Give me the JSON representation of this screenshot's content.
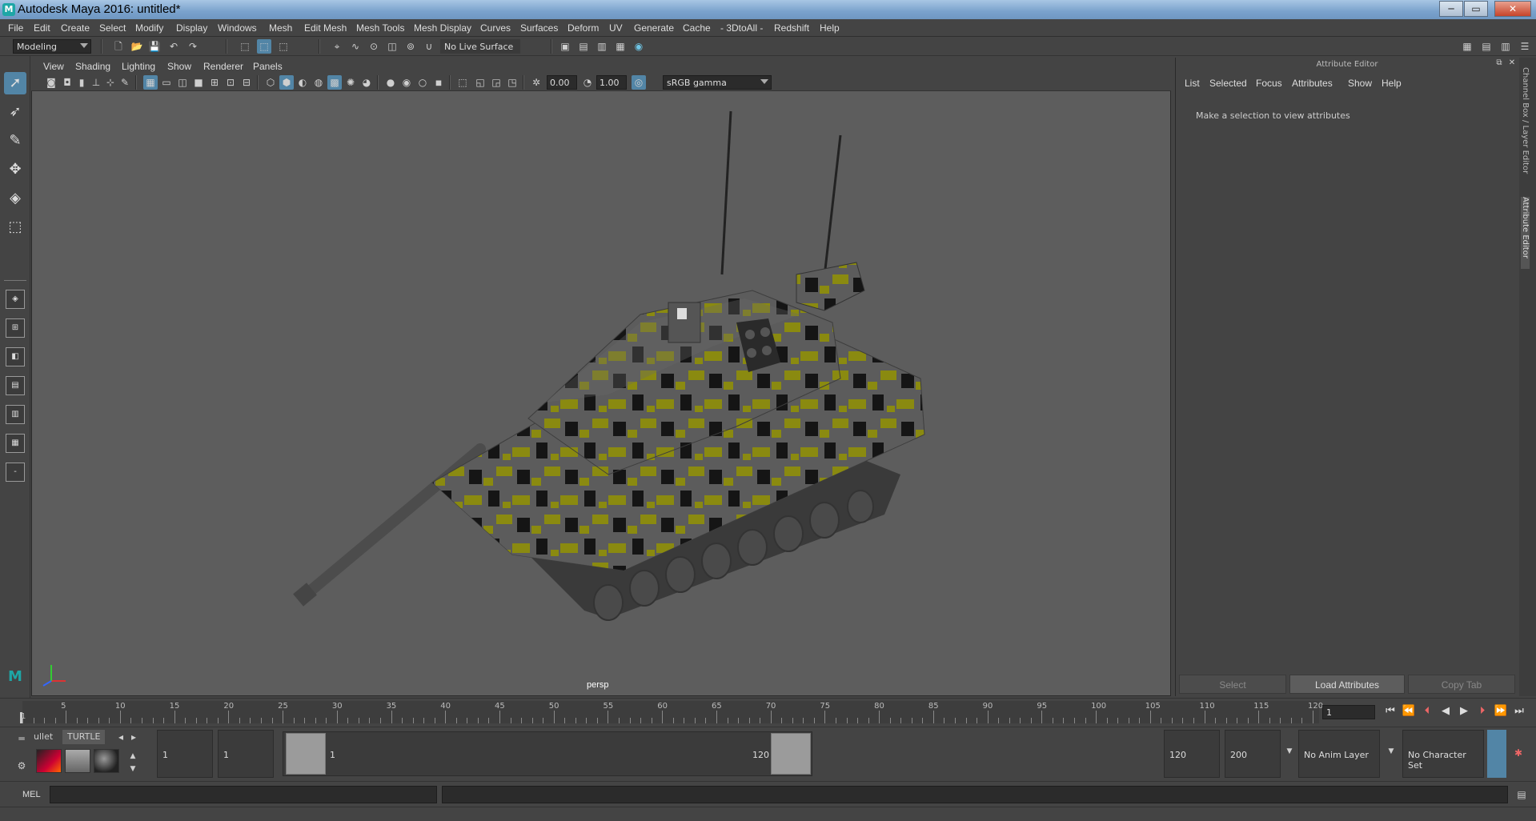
{
  "window": {
    "title": "Autodesk Maya 2016: untitled*",
    "minimize": "─",
    "maximize": "▭",
    "close": "✕"
  },
  "menu": [
    "File",
    "Edit",
    "Create",
    "Select",
    "Modify",
    "Display",
    "Windows",
    "Mesh",
    "Edit Mesh",
    "Mesh Tools",
    "Mesh Display",
    "Curves",
    "Surfaces",
    "Deform",
    "UV",
    "Generate",
    "Cache",
    "- 3DtoAll -",
    "Redshift",
    "Help"
  ],
  "status_line": {
    "mode": "Modeling",
    "live_surface": "No Live Surface"
  },
  "viewport": {
    "menu": [
      "View",
      "Shading",
      "Lighting",
      "Show",
      "Renderer",
      "Panels"
    ],
    "exposure": "0.00",
    "gamma": "1.00",
    "color_space": "sRGB gamma",
    "camera": "persp",
    "colors": {
      "bg": "#5d5d5d",
      "camo_yellow": "#8a8a10",
      "camo_black": "#151515",
      "hull": "#5e5e5e"
    }
  },
  "attribute_editor": {
    "title": "Attribute Editor",
    "menu": [
      "List",
      "Selected",
      "Focus",
      "Attributes",
      "Show",
      "Help"
    ],
    "message": "Make a selection to view attributes",
    "buttons": {
      "select": "Select",
      "load": "Load Attributes",
      "copy": "Copy Tab"
    }
  },
  "side_tabs": {
    "channel_box": "Channel Box / Layer Editor",
    "attribute_editor": "Attribute Editor"
  },
  "timeline": {
    "ticks": [
      "5",
      "10",
      "15",
      "20",
      "25",
      "30",
      "35",
      "40",
      "45",
      "50",
      "55",
      "60",
      "65",
      "70",
      "75",
      "80",
      "85",
      "90",
      "95",
      "100",
      "105",
      "110",
      "115",
      "120"
    ],
    "start_label": "1",
    "current_frame": "1"
  },
  "range": {
    "shelf_tabs": [
      "ullet",
      "TURTLE"
    ],
    "start": "1",
    "playback_start": "1",
    "slider_start": "1",
    "slider_end": "120",
    "playback_end": "120",
    "end": "200",
    "anim_layer": "No Anim Layer",
    "character_set": "No Character Set"
  },
  "command": {
    "label": "MEL"
  }
}
